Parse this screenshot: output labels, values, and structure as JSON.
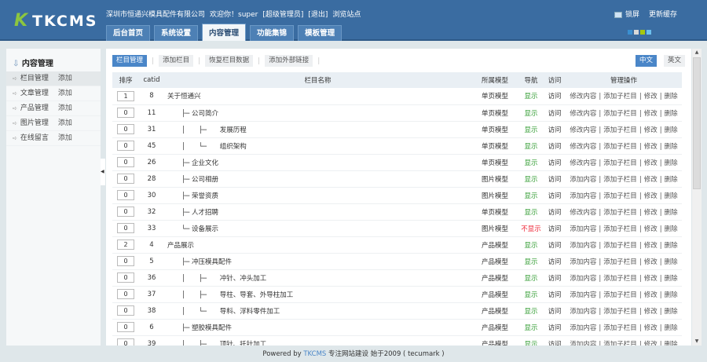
{
  "header": {
    "logo_mark": "K",
    "logo_text": "TKCMS",
    "company": "深圳市恒通兴模具配件有限公司",
    "welcome": "欢迎你！super",
    "role": "[超级管理员]",
    "logout": "[退出]",
    "browse": "浏览站点",
    "lock": "锁屏",
    "refresh_cache": "更新缓存",
    "tabs": [
      {
        "label": "后台首页"
      },
      {
        "label": "系统设置"
      },
      {
        "label": "内容管理"
      },
      {
        "label": "功能集锦"
      },
      {
        "label": "模板管理"
      }
    ],
    "skin_colors": [
      "#3a8fd0",
      "#d8d8d8",
      "#a6c80e",
      "#6cc0ee"
    ]
  },
  "sidebar": {
    "title": "内容管理",
    "items": [
      {
        "label": "栏目管理",
        "add": "添加"
      },
      {
        "label": "文章管理",
        "add": "添加"
      },
      {
        "label": "产品管理",
        "add": "添加"
      },
      {
        "label": "图片管理",
        "add": "添加"
      },
      {
        "label": "在线留言",
        "add": "添加"
      }
    ]
  },
  "subnav": {
    "buttons": [
      "栏目管理",
      "添加栏目",
      "恢复栏目数据",
      "添加外部链接"
    ],
    "lang": [
      "中文",
      "英文"
    ]
  },
  "table": {
    "headers": [
      "排序",
      "catid",
      "栏目名称",
      "所属模型",
      "导航",
      "访问",
      "管理操作"
    ],
    "ops": {
      "edit": "修改",
      "delete": "删除",
      "add_sub": "添加子栏目"
    },
    "rows": [
      {
        "sort": "1",
        "catid": "8",
        "name": "关于恒通兴",
        "prefix": "",
        "model": "单页模型",
        "nav": "显示",
        "visit": "访问",
        "op1": "修改内容"
      },
      {
        "sort": "0",
        "catid": "11",
        "name": "公司简介",
        "prefix": "├─ ",
        "model": "单页模型",
        "nav": "显示",
        "visit": "访问",
        "op1": "修改内容"
      },
      {
        "sort": "0",
        "catid": "31",
        "name": "发展历程",
        "prefix": "│ ├─ ",
        "model": "单页模型",
        "nav": "显示",
        "visit": "访问",
        "op1": "修改内容"
      },
      {
        "sort": "0",
        "catid": "45",
        "name": "组织架构",
        "prefix": "│ └─ ",
        "model": "单页模型",
        "nav": "显示",
        "visit": "访问",
        "op1": "修改内容"
      },
      {
        "sort": "0",
        "catid": "26",
        "name": "企业文化",
        "prefix": "├─ ",
        "model": "单页模型",
        "nav": "显示",
        "visit": "访问",
        "op1": "修改内容"
      },
      {
        "sort": "0",
        "catid": "28",
        "name": "公司相册",
        "prefix": "├─ ",
        "model": "图片模型",
        "nav": "显示",
        "visit": "访问",
        "op1": "添加内容"
      },
      {
        "sort": "0",
        "catid": "30",
        "name": "荣誉资质",
        "prefix": "├─ ",
        "model": "图片模型",
        "nav": "显示",
        "visit": "访问",
        "op1": "添加内容"
      },
      {
        "sort": "0",
        "catid": "32",
        "name": "人才招聘",
        "prefix": "├─ ",
        "model": "单页模型",
        "nav": "显示",
        "visit": "访问",
        "op1": "修改内容"
      },
      {
        "sort": "0",
        "catid": "33",
        "name": "设备展示",
        "prefix": "└─ ",
        "model": "图片模型",
        "nav": "不显示",
        "visit": "访问",
        "op1": "添加内容"
      },
      {
        "sort": "2",
        "catid": "4",
        "name": "产品展示",
        "prefix": "",
        "model": "产品模型",
        "nav": "显示",
        "visit": "访问",
        "op1": "添加内容"
      },
      {
        "sort": "0",
        "catid": "5",
        "name": "冲压模具配件",
        "prefix": "├─ ",
        "model": "产品模型",
        "nav": "显示",
        "visit": "访问",
        "op1": "添加内容"
      },
      {
        "sort": "0",
        "catid": "36",
        "name": "冲针、冲头加工",
        "prefix": "│ ├─ ",
        "model": "产品模型",
        "nav": "显示",
        "visit": "访问",
        "op1": "添加内容"
      },
      {
        "sort": "0",
        "catid": "37",
        "name": "导柱、导套、外导柱加工",
        "prefix": "│ ├─ ",
        "model": "产品模型",
        "nav": "显示",
        "visit": "访问",
        "op1": "添加内容"
      },
      {
        "sort": "0",
        "catid": "38",
        "name": "导料、浮料零件加工",
        "prefix": "│ └─ ",
        "model": "产品模型",
        "nav": "显示",
        "visit": "访问",
        "op1": "添加内容"
      },
      {
        "sort": "0",
        "catid": "6",
        "name": "塑胶模具配件",
        "prefix": "├─ ",
        "model": "产品模型",
        "nav": "显示",
        "visit": "访问",
        "op1": "添加内容"
      },
      {
        "sort": "0",
        "catid": "39",
        "name": "顶针、托针加工",
        "prefix": "│ ├─ ",
        "model": "产品模型",
        "nav": "显示",
        "visit": "访问",
        "op1": "添加内容"
      }
    ]
  },
  "footer": {
    "powered": "Powered by",
    "brand": "TKCMS",
    "slogan": "专注网站建设  始于2009 ( tecumark )"
  }
}
